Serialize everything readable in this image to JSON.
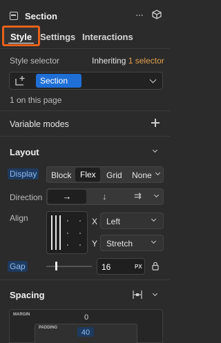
{
  "header": {
    "title": "Section",
    "more_icon": "ellipsis-icon",
    "component_icon": "cube-icon"
  },
  "tabs": [
    {
      "label": "Style",
      "active": true
    },
    {
      "label": "Settings",
      "active": false
    },
    {
      "label": "Interactions",
      "active": false
    }
  ],
  "style_selector": {
    "label": "Style selector",
    "inheriting_prefix": "Inheriting",
    "inheriting_count": "1 selector",
    "chip": "Section",
    "on_page": "1 on this page"
  },
  "variable_modes": {
    "label": "Variable modes"
  },
  "layout": {
    "title": "Layout",
    "display_label": "Display",
    "display_options": [
      "Block",
      "Flex",
      "Grid",
      "None"
    ],
    "display_selected": "Flex",
    "direction_label": "Direction",
    "direction_options": [
      "→",
      "↓",
      "⇉"
    ],
    "align_label": "Align",
    "x_label": "X",
    "x_value": "Left",
    "y_label": "Y",
    "y_value": "Stretch",
    "gap_label": "Gap",
    "gap_value": "16",
    "gap_unit": "PX",
    "gap_slider_fraction": 0.22
  },
  "spacing": {
    "title": "Spacing",
    "margin_label": "MARGIN",
    "margin_value": "0",
    "padding_label": "PADDING",
    "padding_value": "40"
  },
  "colors": {
    "accent": "#1f6fd6",
    "active_tab_outline": "#e8611a",
    "bound_highlight": "#1e3a5f"
  }
}
